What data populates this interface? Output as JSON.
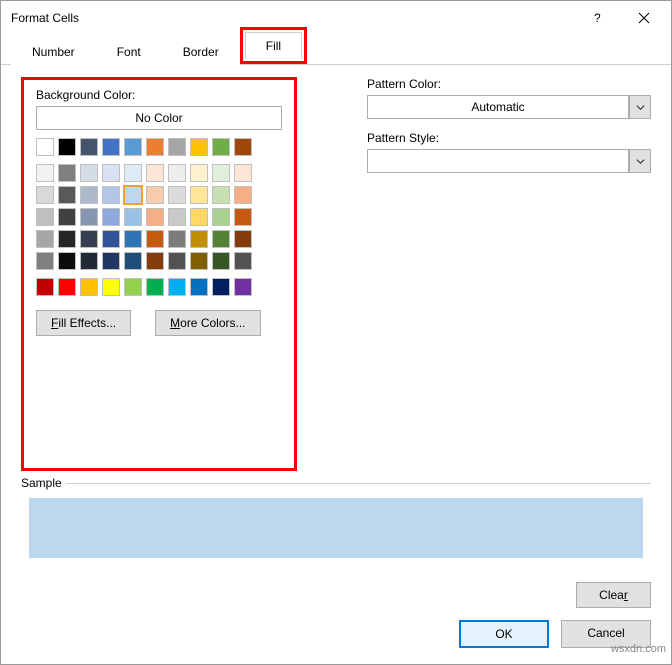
{
  "title": "Format Cells",
  "tabs": [
    "Number",
    "Font",
    "Border",
    "Fill"
  ],
  "active_tab": "Fill",
  "labels": {
    "background_color": "Background Color:",
    "no_color": "No Color",
    "fill_effects": "Fill Effects...",
    "more_colors": "More Colors...",
    "pattern_color": "Pattern Color:",
    "pattern_style": "Pattern Style:",
    "automatic": "Automatic",
    "sample": "Sample",
    "clear": "Clear",
    "ok": "OK",
    "cancel": "Cancel"
  },
  "palette": {
    "theme_row": [
      "#ffffff",
      "#000000",
      "#44546a",
      "#4472c4",
      "#5b9bd5",
      "#ed7d31",
      "#a5a5a5",
      "#ffc000",
      "#70ad47",
      "#9e480e"
    ],
    "shades": [
      [
        "#f2f2f2",
        "#7f7f7f",
        "#d6dce4",
        "#d9e1f2",
        "#deebf6",
        "#fce4d6",
        "#ededed",
        "#fff2cc",
        "#e2efda",
        "#fbe5d6"
      ],
      [
        "#d9d9d9",
        "#595959",
        "#acb9ca",
        "#b4c6e7",
        "#bdd7ee",
        "#f8cbad",
        "#dbdbdb",
        "#ffe699",
        "#c6e0b4",
        "#f4b084"
      ],
      [
        "#bfbfbf",
        "#404040",
        "#8496b0",
        "#8ea9db",
        "#9bc2e6",
        "#f4b084",
        "#c9c9c9",
        "#ffd966",
        "#a9d08e",
        "#c65911"
      ],
      [
        "#a6a6a6",
        "#262626",
        "#333f4f",
        "#305496",
        "#2f75b5",
        "#c65911",
        "#7b7b7b",
        "#bf8f00",
        "#548235",
        "#833c0c"
      ],
      [
        "#808080",
        "#0d0d0d",
        "#222b35",
        "#203764",
        "#1f4e78",
        "#833c0c",
        "#525252",
        "#806000",
        "#375623",
        "#525252"
      ]
    ],
    "standard": [
      "#c00000",
      "#ff0000",
      "#ffc000",
      "#ffff00",
      "#92d050",
      "#00b050",
      "#00b0f0",
      "#0070c0",
      "#002060",
      "#7030a0"
    ],
    "selected": "#bdd7ee"
  },
  "sample_color": "#bdd7ee",
  "watermark": "wsxdn.com",
  "chart_data": null
}
